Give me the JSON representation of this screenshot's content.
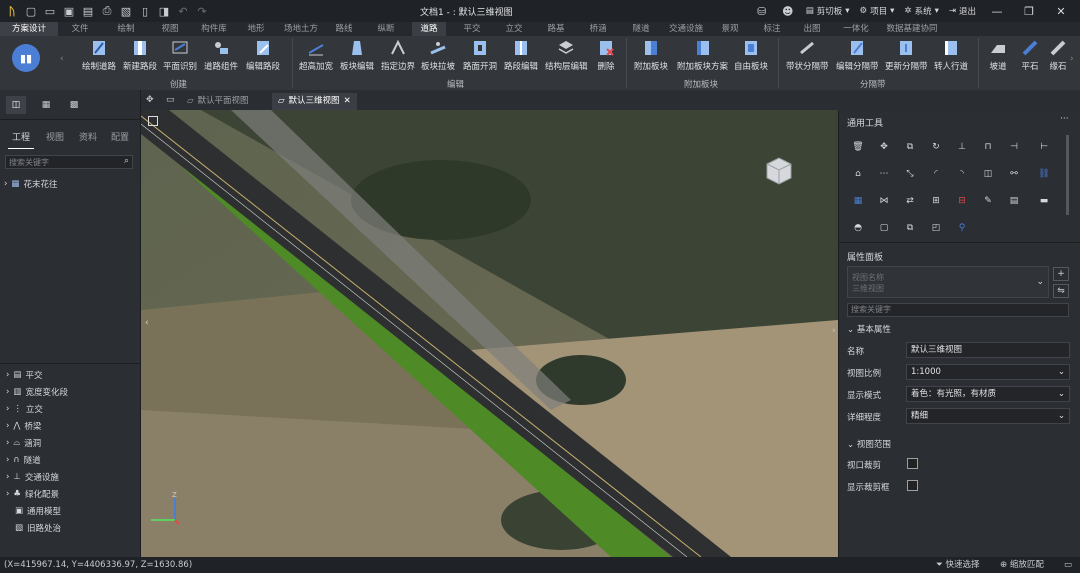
{
  "title_bar": {
    "document_title": "文档1 - : 默认三维视图",
    "tools": [
      "剪切板",
      "项目",
      "系统",
      "退出"
    ]
  },
  "menu_tabs": [
    "方案设计",
    "文件",
    "绘制",
    "视图",
    "构件库",
    "地形",
    "场地土方",
    "路线",
    "纵断",
    "道路",
    "平交",
    "立交",
    "路基",
    "桥涵",
    "隧道",
    "交通设施",
    "景观",
    "标注",
    "出图",
    "一体化",
    "数据基建协同"
  ],
  "active_tab": "道路",
  "ribbon": {
    "groups": [
      {
        "label": "创建",
        "buttons": [
          "绘制道路",
          "新建路段",
          "平面识别",
          "道路组件",
          "编辑路段"
        ]
      },
      {
        "label": "编辑",
        "buttons": [
          "超高加宽",
          "板块编辑",
          "指定边界",
          "板块拉坡",
          "路面开洞",
          "路段编辑",
          "结构层编辑",
          "删除"
        ]
      },
      {
        "label": "附加板块",
        "buttons": [
          "附加板块",
          "附加板块方案",
          "自由板块"
        ]
      },
      {
        "label": "分隔带",
        "buttons": [
          "带状分隔带",
          "编辑分隔带",
          "更新分隔带",
          "转人行道"
        ]
      },
      {
        "label": "",
        "buttons": [
          "坡道",
          "平石",
          "缘石"
        ]
      }
    ]
  },
  "doc_tabs": [
    "默认平面视图",
    "默认三维视图"
  ],
  "active_doc_tab": "默认三维视图",
  "left_panel": {
    "tabs": [
      "工程",
      "视图",
      "资料",
      "配置"
    ],
    "active_tab": "工程",
    "search_placeholder": "搜索关键字",
    "tree_root": "花末花往",
    "categories": [
      "平交",
      "宽度变化段",
      "立交",
      "桥梁",
      "涵洞",
      "隧道",
      "交通设施",
      "绿化配景",
      "通用模型",
      "旧路处治"
    ]
  },
  "right_panel": {
    "tools_title": "通用工具",
    "props_title": "属性面板",
    "props_placeholder_1": "视图名称",
    "props_placeholder_2": "三维视图",
    "search_placeholder": "搜索关键字",
    "section_basic": "基本属性",
    "section_range": "视图范围",
    "fields": [
      {
        "label": "名称",
        "value": "默认三维视图"
      },
      {
        "label": "视图比例",
        "value": "1:1000"
      },
      {
        "label": "显示模式",
        "value": "着色：有光照，有材质"
      },
      {
        "label": "详细程度",
        "value": "精细"
      }
    ],
    "checks": [
      {
        "label": "视口裁剪",
        "checked": false
      },
      {
        "label": "显示裁剪框",
        "checked": false
      }
    ]
  },
  "status_bar": {
    "coords": "(X=415967.14, Y=4406336.97, Z=1630.86)",
    "quick_select": "快速选择",
    "zoom_match": "缩放匹配"
  },
  "colors": {
    "accent": "#4b7fd6",
    "road": "#3a3a3a",
    "green": "#5d9a2f"
  }
}
